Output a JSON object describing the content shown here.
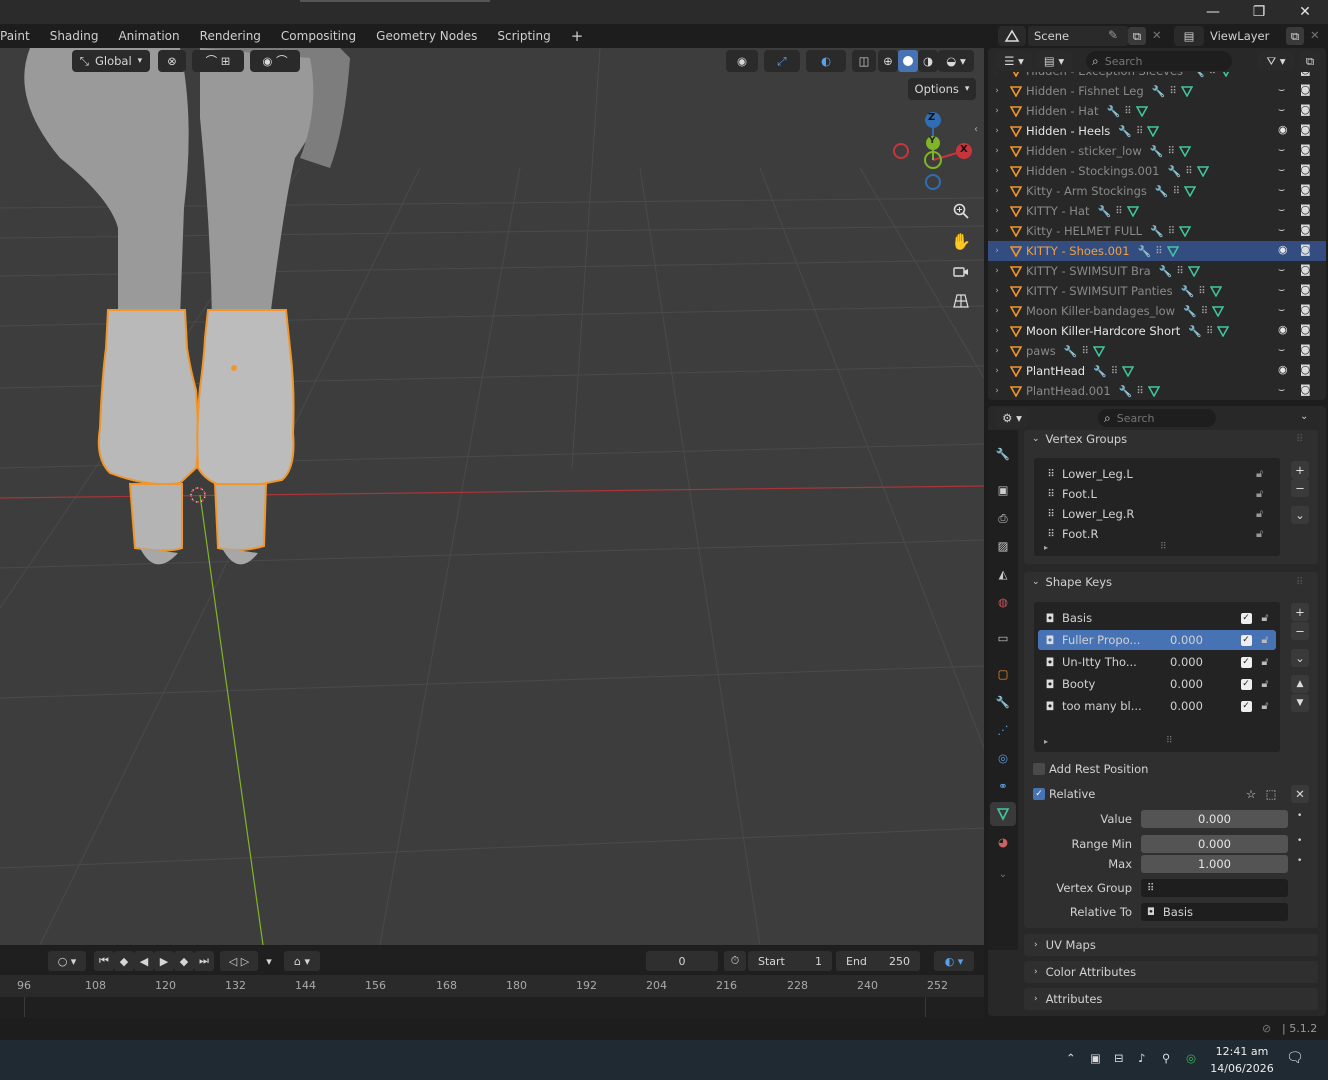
{
  "window": {
    "minimize": "—",
    "maximize": "❐",
    "close": "✕"
  },
  "workspace_tabs": [
    "Paint",
    "Shading",
    "Animation",
    "Rendering",
    "Compositing",
    "Geometry Nodes",
    "Scripting"
  ],
  "add_workspace": "+",
  "scene": {
    "name": "Scene",
    "view_layer": "ViewLayer"
  },
  "viewport": {
    "orientation": "Global",
    "options_label": "Options",
    "gizmo": {
      "z": "Z",
      "y": "Y",
      "x": "X"
    }
  },
  "outliner": {
    "search_placeholder": "Search",
    "items": [
      {
        "name": "Hidden - Exception Sleeves",
        "dim": true,
        "visible": false
      },
      {
        "name": "Hidden - Fishnet Leg",
        "dim": true,
        "visible": false
      },
      {
        "name": "Hidden - Hat",
        "dim": true,
        "visible": false
      },
      {
        "name": "Hidden - Heels",
        "dim": false,
        "visible": true
      },
      {
        "name": "Hidden - sticker_low",
        "dim": true,
        "visible": false
      },
      {
        "name": "Hidden - Stockings.001",
        "dim": true,
        "visible": false
      },
      {
        "name": "Kitty - Arm Stockings",
        "dim": true,
        "visible": false
      },
      {
        "name": "KITTY - Hat",
        "dim": true,
        "visible": false
      },
      {
        "name": "Kitty - HELMET FULL",
        "dim": true,
        "visible": false
      },
      {
        "name": "KITTY - Shoes.001",
        "dim": false,
        "visible": true,
        "selected": true
      },
      {
        "name": "KITTY - SWIMSUIT Bra",
        "dim": true,
        "visible": false
      },
      {
        "name": "KITTY - SWIMSUIT Panties",
        "dim": true,
        "visible": false
      },
      {
        "name": "Moon Killer-bandages_low",
        "dim": true,
        "visible": false
      },
      {
        "name": "Moon Killer-Hardcore Short",
        "dim": false,
        "visible": true
      },
      {
        "name": "paws",
        "dim": true,
        "visible": false
      },
      {
        "name": "PlantHead",
        "dim": false,
        "visible": true
      },
      {
        "name": "PlantHead.001",
        "dim": true,
        "visible": false
      }
    ]
  },
  "properties": {
    "search_placeholder": "Search",
    "vertex_groups": {
      "title": "Vertex Groups",
      "items": [
        "Lower_Leg.L",
        "Foot.L",
        "Lower_Leg.R",
        "Foot.R"
      ]
    },
    "shape_keys": {
      "title": "Shape Keys",
      "items": [
        {
          "name": "Basis",
          "value": ""
        },
        {
          "name": "Fuller Propo...",
          "value": "0.000",
          "selected": true
        },
        {
          "name": "Un-Itty Tho...",
          "value": "0.000"
        },
        {
          "name": "Booty",
          "value": "0.000"
        },
        {
          "name": "too many bl...",
          "value": "0.000"
        }
      ],
      "add_rest_position": "Add Rest Position",
      "relative": "Relative",
      "value_label": "Value",
      "value": "0.000",
      "range_min_label": "Range Min",
      "range_min": "0.000",
      "max_label": "Max",
      "max": "1.000",
      "vertex_group_label": "Vertex Group",
      "relative_to_label": "Relative To",
      "relative_to": "Basis"
    },
    "collapsed_panels": [
      "UV Maps",
      "Color Attributes",
      "Attributes"
    ]
  },
  "timeline": {
    "current_frame": "0",
    "start_label": "Start",
    "start": "1",
    "end_label": "End",
    "end": "250",
    "ticks": [
      "96",
      "108",
      "120",
      "132",
      "144",
      "156",
      "168",
      "180",
      "192",
      "204",
      "216",
      "228",
      "240",
      "252"
    ]
  },
  "status": {
    "version": "5.1.2"
  },
  "taskbar": {
    "time": "12:41 am",
    "date": "14/06/2026"
  },
  "colors": {
    "accent": "#4772b3",
    "selection_outline": "#f0962a",
    "x_axis": "#c8343c",
    "y_axis": "#7fb526",
    "z_axis": "#2f6db5"
  }
}
